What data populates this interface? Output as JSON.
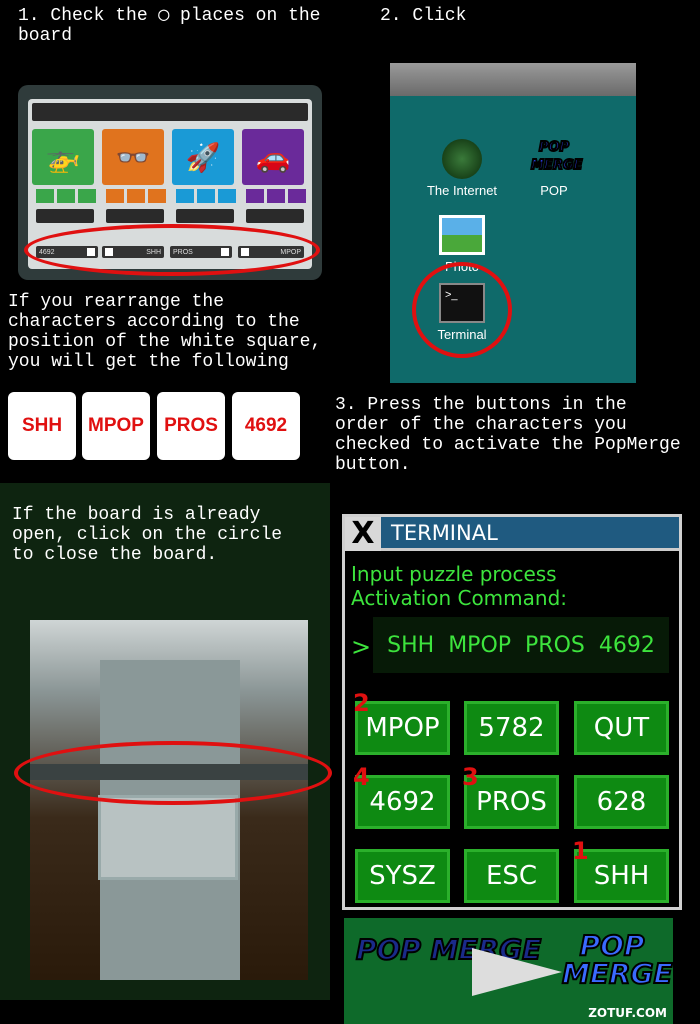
{
  "step1": {
    "text": "1. Check the ◯ places on the board"
  },
  "step2": {
    "text": "2. Click"
  },
  "board": {
    "tiles": [
      {
        "icon": "helicopter-icon",
        "color": "#3aa64a"
      },
      {
        "icon": "3d-glasses-icon",
        "color": "#e0731e"
      },
      {
        "icon": "rocket-icon",
        "color": "#1a9ad6"
      },
      {
        "icon": "car-icon",
        "color": "#6a2a9a"
      }
    ],
    "slots": [
      "4692",
      "SHH",
      "PROS",
      "MPOP"
    ]
  },
  "rearrange": {
    "text": "If you rearrange the characters according to the position of the white square, you will get the following"
  },
  "result_cards": [
    "SHH",
    "MPOP",
    "PROS",
    "4692"
  ],
  "desktop": {
    "icons": [
      {
        "label": "The Internet"
      },
      {
        "label": "POP"
      },
      {
        "label": "Photo"
      },
      {
        "label": "Terminal"
      }
    ],
    "pop_logo": "POP MERGE"
  },
  "step3": {
    "text": "3. Press the buttons in the order of the characters you checked to activate the PopMerge button."
  },
  "close_board": {
    "text": "If the board is already open, click on the circle to close the board."
  },
  "terminal": {
    "title": "TERMINAL",
    "close": "X",
    "prompt_line1": "Input puzzle process",
    "prompt_line2": "Activation Command:",
    "caret": ">",
    "command": "SHH  MPOP  PROS  4692",
    "buttons": [
      {
        "label": "MPOP",
        "order": "2"
      },
      {
        "label": "5782",
        "order": ""
      },
      {
        "label": "QUT",
        "order": ""
      },
      {
        "label": "4692",
        "order": "4"
      },
      {
        "label": "PROS",
        "order": "3"
      },
      {
        "label": "628",
        "order": ""
      },
      {
        "label": "SYSZ",
        "order": ""
      },
      {
        "label": "ESC",
        "order": ""
      },
      {
        "label": "SHH",
        "order": "1"
      }
    ]
  },
  "popmerge": {
    "before": "POP MERGE",
    "after": "POP MERGE"
  },
  "watermark": "ZOTUF.COM",
  "colors": {
    "highlight": "#e01010",
    "terminal_green": "#3de43d",
    "button_green": "#0e8a12"
  }
}
